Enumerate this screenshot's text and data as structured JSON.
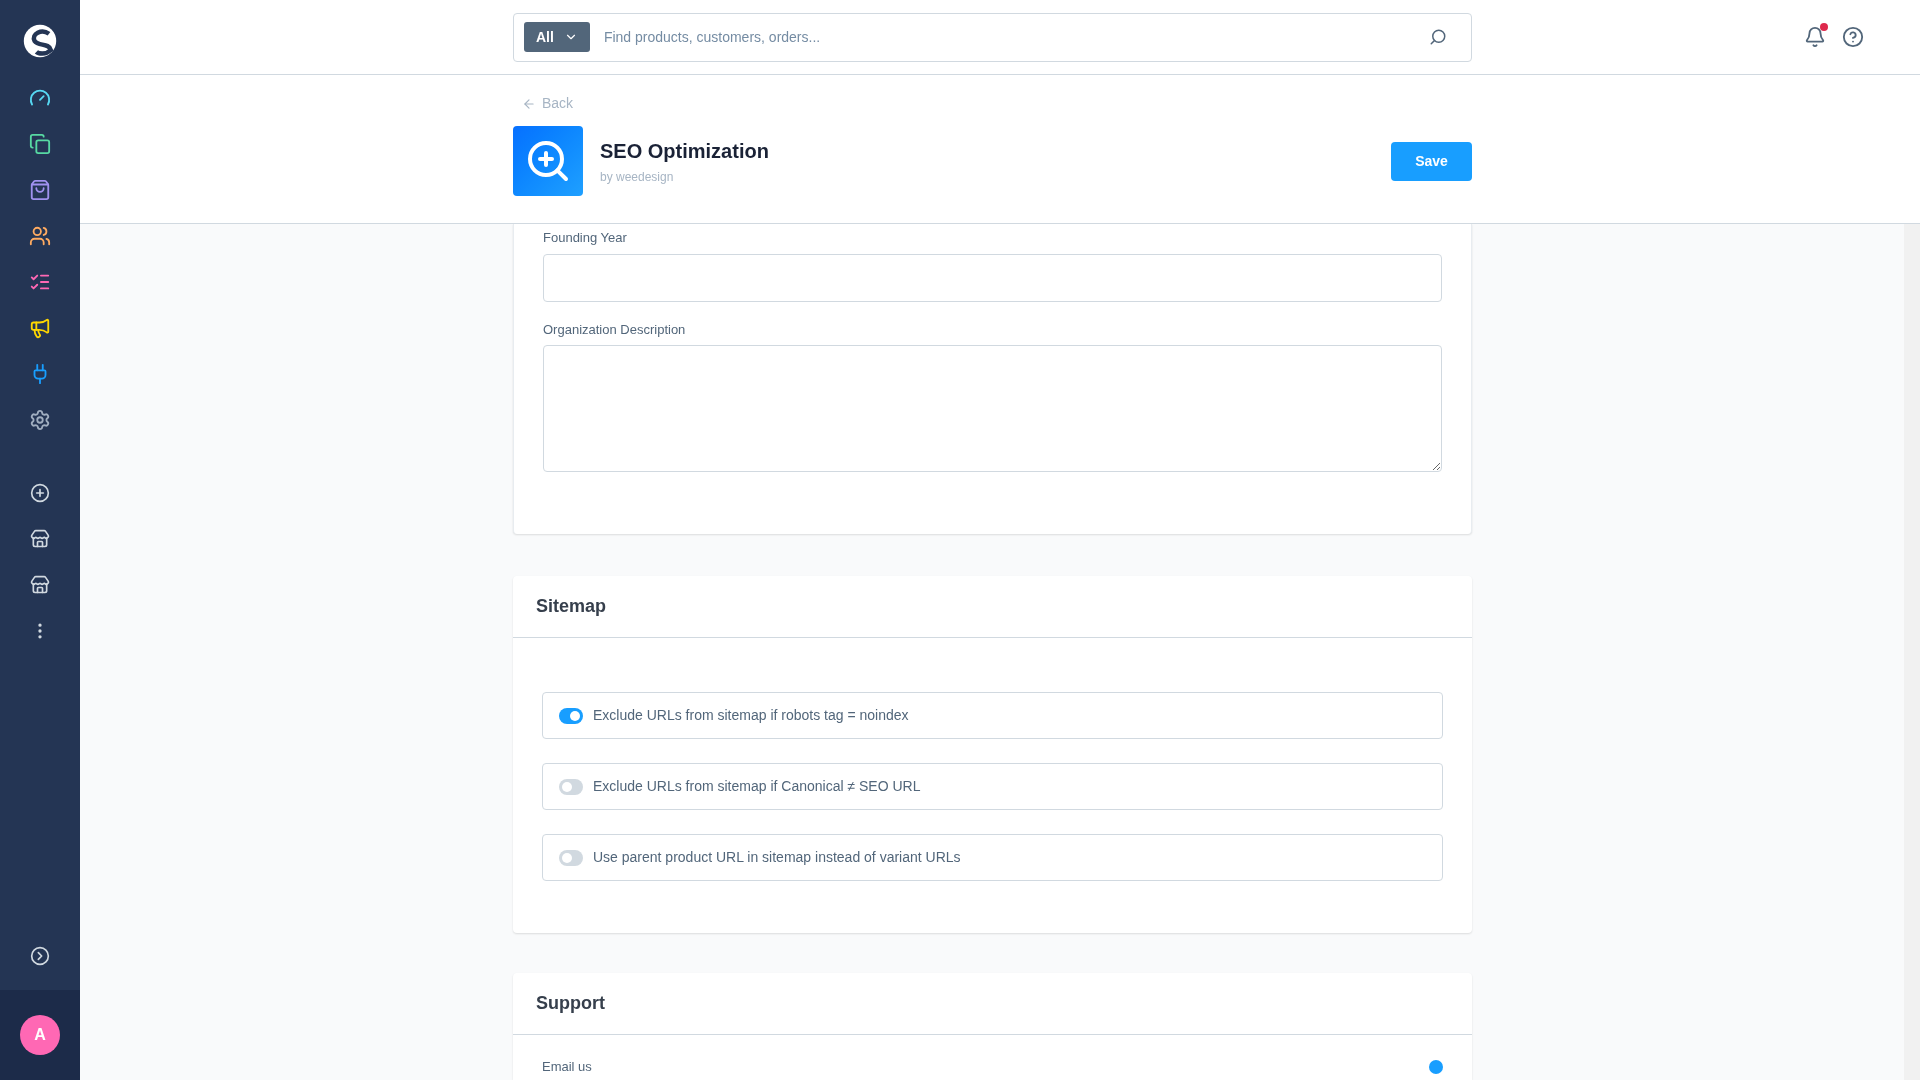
{
  "sidebar": {
    "avatar": "A"
  },
  "search": {
    "scope": "All",
    "placeholder": "Find products, customers, orders..."
  },
  "notifications": {
    "unread": true
  },
  "page_header": {
    "back": "Back",
    "title": "SEO Optimization",
    "vendor": "by weedesign",
    "save": "Save"
  },
  "organization": {
    "fields": [
      {
        "kind": "input",
        "label": "Founding Year"
      },
      {
        "kind": "textarea",
        "label": "Organization Description"
      }
    ]
  },
  "sitemap": {
    "title": "Sitemap",
    "toggles": [
      {
        "label": "Exclude URLs from sitemap if robots tag = noindex",
        "on": true
      },
      {
        "label": "Exclude URLs from sitemap if Canonical ≠ SEO URL",
        "on": false
      },
      {
        "label": "Use parent product URL in sitemap instead of variant URLs",
        "on": false
      }
    ]
  },
  "support": {
    "title": "Support",
    "items": [
      {
        "label": "Email us"
      }
    ]
  }
}
